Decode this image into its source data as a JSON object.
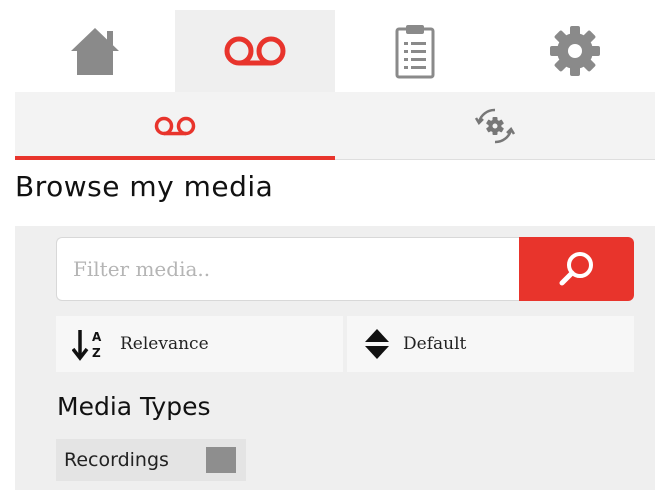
{
  "nav": {
    "tabs": [
      {
        "icon": "home-icon",
        "active": false
      },
      {
        "icon": "voicemail-icon",
        "active": true
      },
      {
        "icon": "clipboard-icon",
        "active": false
      },
      {
        "icon": "gear-icon",
        "active": false
      }
    ]
  },
  "subtabs": [
    {
      "icon": "voicemail-icon",
      "active": true
    },
    {
      "icon": "sync-settings-icon",
      "active": false
    }
  ],
  "page": {
    "title": "Browse my media"
  },
  "filter": {
    "placeholder": "Filter media..",
    "value": ""
  },
  "sort": {
    "order_label": "Relevance",
    "default_label": "Default"
  },
  "media_types": {
    "title": "Media Types",
    "items": [
      {
        "label": "Recordings",
        "checked": false
      }
    ]
  },
  "colors": {
    "accent": "#e8342c",
    "icon_gray": "#8a8a8a",
    "panel_bg": "#efefef"
  }
}
